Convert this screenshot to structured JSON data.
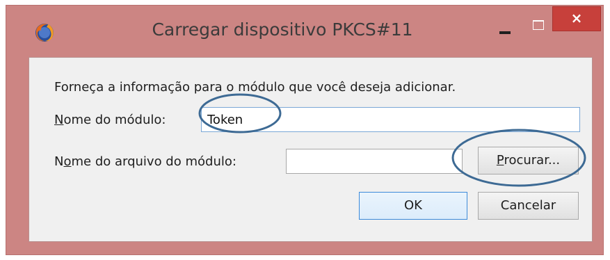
{
  "window": {
    "title": "Carregar dispositivo PKCS#11",
    "close_glyph": "×",
    "frame_color": "#cc8583",
    "close_color": "#c7403b"
  },
  "dialog": {
    "instruction": "Forneça a informação para o módulo que você deseja adicionar.",
    "module_name": {
      "label_accesskey": "N",
      "label_rest": "ome do módulo:",
      "value": "Token"
    },
    "module_file": {
      "label_pre": "N",
      "label_accesskey": "o",
      "label_rest": "me do arquivo do módulo:",
      "value": ""
    },
    "buttons": {
      "browse_accesskey": "P",
      "browse_rest": "rocurar...",
      "ok": "OK",
      "cancel": "Cancelar"
    }
  },
  "icons": {
    "app": "firefox-icon",
    "minimize": "minimize-icon",
    "maximize": "maximize-icon",
    "close": "close-icon"
  },
  "annotation_color": "#3d6a94"
}
